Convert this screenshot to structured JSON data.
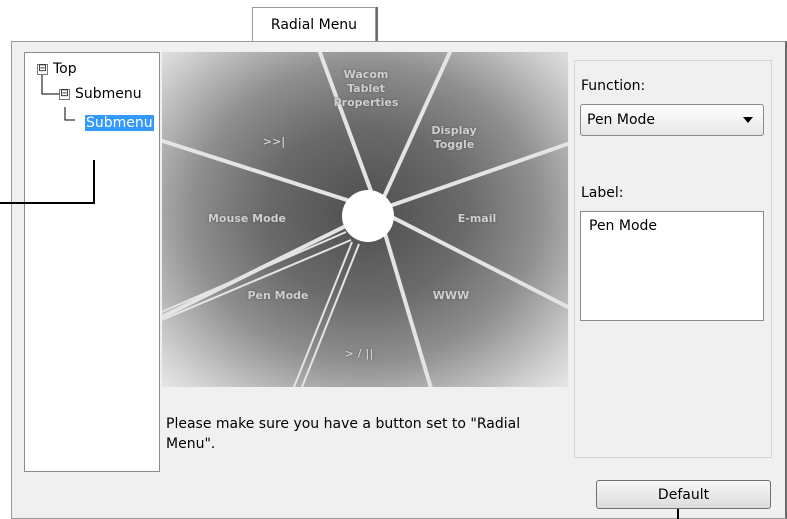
{
  "tabs": [
    {
      "label": "Radial Menu",
      "selected": true
    }
  ],
  "tree": {
    "items": [
      {
        "label": "Top",
        "expander": "⊟",
        "level": 0
      },
      {
        "label": "Submenu",
        "expander": "⊟",
        "level": 1
      },
      {
        "label": "Submenu",
        "level": 2,
        "selected": true
      }
    ]
  },
  "preview": {
    "slices": [
      "Wacom\nTablet\nProperties",
      "Display\nToggle",
      "E-mail",
      "WWW",
      "> / ||",
      "Pen Mode",
      "Mouse Mode",
      ">>|"
    ]
  },
  "help_text": "Please make sure you have a button set to \"Radial Menu\".",
  "function": {
    "label": "Function:",
    "value": "Pen Mode"
  },
  "label_field": {
    "label": "Label:",
    "value": "Pen Mode"
  },
  "default_button": "Default",
  "colors": {
    "selection": "#3399ff",
    "panel": "#f0f0f0"
  }
}
